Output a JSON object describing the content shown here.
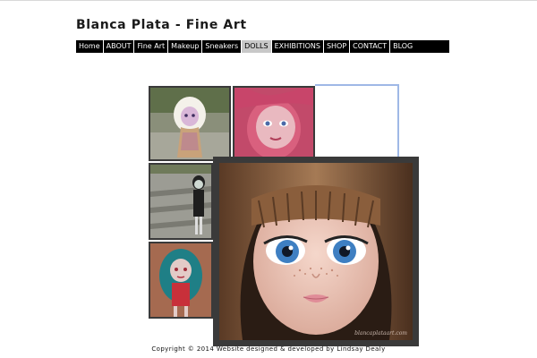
{
  "site": {
    "title": "Blanca Plata - Fine Art"
  },
  "nav": {
    "items": [
      {
        "label": "Home"
      },
      {
        "label": "ABOUT"
      },
      {
        "label": "Fine Art"
      },
      {
        "label": "Makeup"
      },
      {
        "label": "Sneakers"
      },
      {
        "label": "DOLLS",
        "active": true
      },
      {
        "label": "EXHIBITIONS"
      },
      {
        "label": "SHOP"
      },
      {
        "label": "CONTACT"
      },
      {
        "label": "BLOG"
      }
    ]
  },
  "gallery": {
    "thumbnails": [
      {
        "subject": "white-haired doll in garden"
      },
      {
        "subject": "pink-haired doll close-up"
      },
      {
        "subject": "doll on stone steps"
      },
      {
        "subject": "teal-haired doll"
      }
    ],
    "featured": {
      "subject": "brown-haired doll with freckles close-up",
      "watermark": "blancaplataart.com"
    }
  },
  "footer": {
    "text": "Copyright © 2014 Website designed & developed by Lindsay Dealy"
  },
  "colors": {
    "nav_bg": "#000000",
    "nav_active_bg": "#c8c8c8",
    "frame": "#3a3a3a",
    "highlight_border": "#9fb8e6"
  }
}
